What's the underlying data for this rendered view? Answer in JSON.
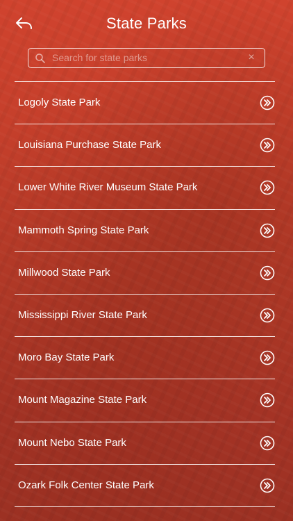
{
  "header": {
    "title": "State Parks",
    "back_icon": "back-arrow-icon"
  },
  "search": {
    "placeholder": "Search for state parks",
    "value": "",
    "search_icon": "search-icon",
    "clear_icon": "clear-icon",
    "clear_glyph": "×"
  },
  "parks": [
    {
      "label": "Logoly State Park"
    },
    {
      "label": "Louisiana Purchase State Park"
    },
    {
      "label": "Lower White River Museum State Park"
    },
    {
      "label": "Mammoth Spring State Park"
    },
    {
      "label": "Millwood State Park"
    },
    {
      "label": "Mississippi River State Park"
    },
    {
      "label": "Moro Bay State Park"
    },
    {
      "label": "Mount Magazine State Park"
    },
    {
      "label": "Mount Nebo State Park"
    },
    {
      "label": "Ozark Folk Center State Park"
    }
  ],
  "row_icon": "double-chevron-right-circle-icon",
  "colors": {
    "background": "#c53f2b",
    "text": "#ffffff"
  }
}
